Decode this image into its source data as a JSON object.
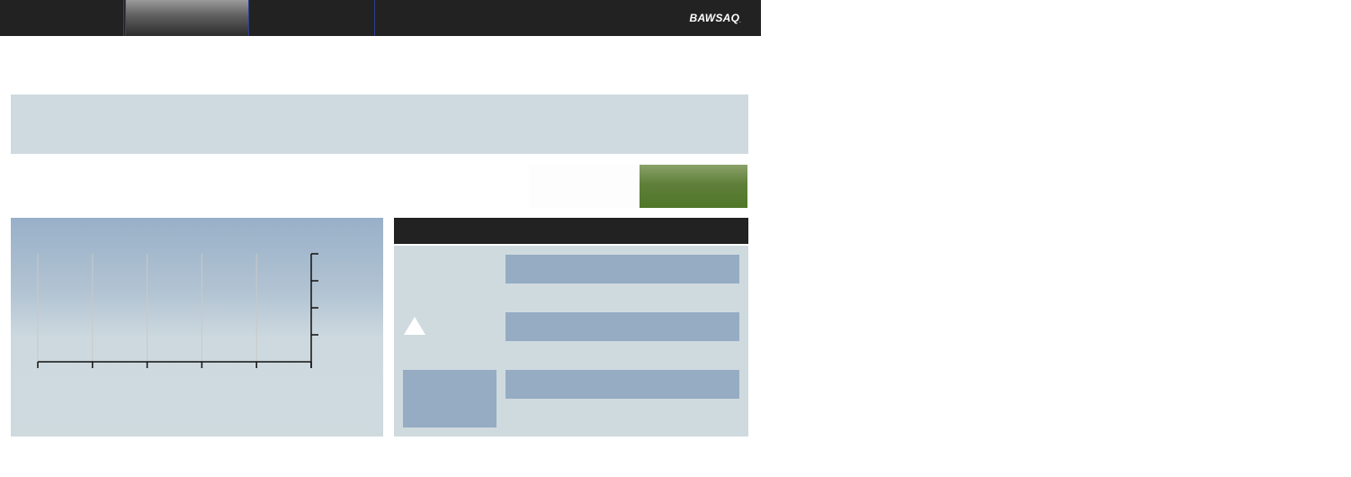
{
  "header": {
    "logo_text": "BAWSAQ",
    "tabs": [
      {
        "label": "",
        "active": false
      },
      {
        "label": "",
        "active": true
      },
      {
        "label": "",
        "active": false
      }
    ]
  },
  "banner": {
    "text": ""
  },
  "actions": {
    "secondary_label": "",
    "primary_label": ""
  },
  "stock_chart": {
    "x_ticks": 6,
    "y_ticks": 5
  },
  "quote_panel": {
    "title": "",
    "trend_icon": "up-arrow-icon",
    "fields": [
      "",
      "",
      ""
    ]
  },
  "colors": {
    "nav_bg": "#222222",
    "panel_bg": "#cfdadf",
    "bar_blue": "#95acc3",
    "buy_green": "#5f7f3a",
    "tab_separator": "#2d3f8c"
  }
}
